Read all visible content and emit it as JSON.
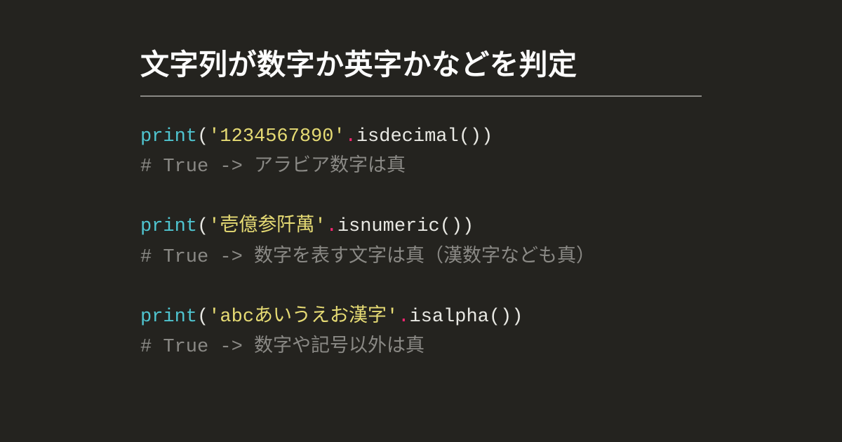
{
  "title": "文字列が数字か英字かなどを判定",
  "code": {
    "blocks": [
      {
        "func": "print",
        "open": "(",
        "str": "'1234567890'",
        "dot": ".",
        "method": "isdecimal",
        "call": "())",
        "comment": "# True -> アラビア数字は真"
      },
      {
        "func": "print",
        "open": "(",
        "str": "'壱億参阡萬'",
        "dot": ".",
        "method": "isnumeric",
        "call": "())",
        "comment": "# True -> 数字を表す文字は真（漢数字なども真）"
      },
      {
        "func": "print",
        "open": "(",
        "str": "'abcあいうえお漢字'",
        "dot": ".",
        "method": "isalpha",
        "call": "())",
        "comment": "# True -> 数字や記号以外は真"
      }
    ]
  }
}
